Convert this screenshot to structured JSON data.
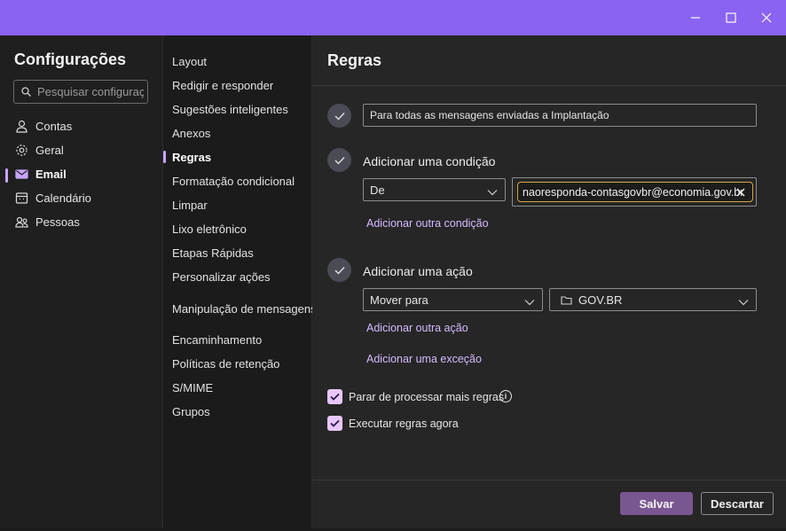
{
  "window": {
    "minimize_icon": "minimize-icon",
    "maximize_icon": "maximize-icon",
    "close_icon": "close-icon"
  },
  "left": {
    "title": "Configurações",
    "search_placeholder": "Pesquisar configurações",
    "items": [
      {
        "label": "Contas",
        "icon": "person-icon"
      },
      {
        "label": "Geral",
        "icon": "gear-icon"
      },
      {
        "label": "Email",
        "icon": "mail-icon",
        "active": true
      },
      {
        "label": "Calendário",
        "icon": "calendar-icon"
      },
      {
        "label": "Pessoas",
        "icon": "people-icon"
      }
    ]
  },
  "middle": {
    "items": [
      "Layout",
      "Redigir e responder",
      "Sugestões inteligentes",
      "Anexos",
      "Regras",
      "Formatação condicional",
      "Limpar",
      "Lixo eletrônico",
      "Etapas Rápidas",
      "Personalizar ações",
      "Manipulação de mensagens",
      "Encaminhamento",
      "Políticas de retenção",
      "S/MIME",
      "Grupos"
    ],
    "active_index": 4
  },
  "rule": {
    "title": "Regras",
    "name_value": "Para todas as mensagens enviadas a Implantação",
    "condition_heading": "Adicionar uma condição",
    "condition_field": "De",
    "condition_chip": "naoresponda-contasgovbr@economia.gov.br",
    "add_condition_link": "Adicionar outra condição",
    "action_heading": "Adicionar uma ação",
    "action_field": "Mover para",
    "action_folder": "GOV.BR",
    "add_action_link": "Adicionar outra ação",
    "add_exception_link": "Adicionar uma exceção",
    "stop_processing_label": "Parar de processar mais regras",
    "stop_processing_checked": true,
    "run_now_label": "Executar regras agora",
    "run_now_checked": true,
    "info_icon": "i"
  },
  "footer": {
    "save_label": "Salvar",
    "discard_label": "Descartar"
  },
  "colors": {
    "titlebar": "#8a63f2",
    "accent": "#c8a6ff",
    "link": "#d8b9ff",
    "chip_border": "#d4a641",
    "save_button": "#7a5691"
  }
}
